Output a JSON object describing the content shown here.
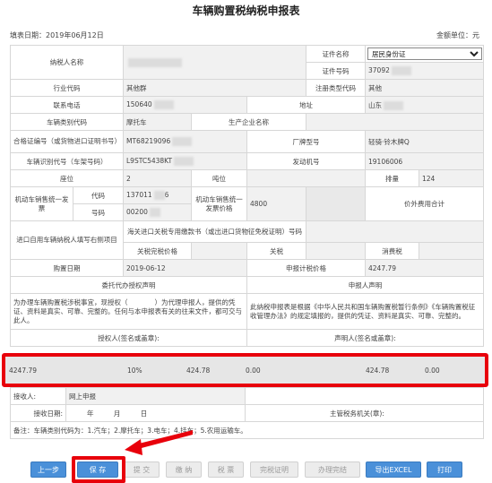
{
  "header": {
    "title": "车辆购置税纳税申报表",
    "fill_date": "填表日期：2019年06月12日",
    "unit": "金额单位：元"
  },
  "taxpayer": {
    "name_label": "纳税人名称",
    "cert_name_label": "证件名称",
    "cert_name_value": "居民身份证",
    "cert_no_label": "证件号码",
    "cert_no_value": "37092",
    "industry_label": "行业代码",
    "industry_value": "其他群",
    "reg_type_label": "注册类型代码",
    "reg_type_value": "其他",
    "phone_label": "联系电话",
    "phone_value": "150640",
    "address_label": "地址",
    "address_value": "山东"
  },
  "vehicle": {
    "type_label": "车辆类别代码",
    "type_value": "摩托车",
    "maker_label": "生产企业名称",
    "cert_label": "合格证编号（或货物进口证明书号）",
    "cert_value": "MT68219096",
    "model_label": "厂牌型号",
    "model_value": "轻骑·铃木牌Q",
    "vin_label": "车辆识别代号（车架号码）",
    "vin_value": "L9STC5438KT",
    "engine_label": "发动机号",
    "engine_value": "19106006",
    "seats_label": "座位",
    "seats_value": "2",
    "tonnage_label": "吨位",
    "displacement_label": "排量",
    "displacement_value": "124",
    "invoice_label": "机动车销售统一发票",
    "code_label": "代码",
    "code_value": "137011",
    "code_suffix": "6",
    "number_label": "号码",
    "number_value": "00200",
    "price_label": "机动车销售统一发票价格",
    "price_value": "4800",
    "extra_fee_label": "价外费用合计"
  },
  "import": {
    "self_use_label": "进口自用车辆纳税人填写右侧项目",
    "customs_label": "海关进口关税专用缴款书（或出进口货物征免税证明）号码",
    "customs_value_label": "关税完税价格",
    "tariff_label": "关税",
    "consumption_label": "消费税"
  },
  "purchase": {
    "date_label": "购置日期",
    "date_value": "2019-06-12",
    "declared_price_label": "申报计税价格",
    "declared_price_value": "4247.79"
  },
  "declaration": {
    "agent_title": "委托代办授权声明",
    "agent_text": "为办理车辆购置税涉税事宜，现授权（　　　　）为代理申报人，提供的凭证、资料是真实、可靠、完整的。任何与本申报表有关的往来文件，都可交与此人。",
    "declarant_title": "申报人声明",
    "declarant_text": "此纳税申报表是根据《中华人民共和国车辆购置税暂行条例》《车辆购置税征收管理办法》的规定填报的，提供的凭证、资料是真实、可靠、完整的。",
    "agent_sign": "授权人(签名或盖章):",
    "declarant_sign": "声明人(签名或盖章):"
  },
  "totals": {
    "tax_base": "4247.79",
    "rate": "10%",
    "tax_payable": "424.78",
    "reduction": "0.00",
    "tax_due": "424.78",
    "paid": "0.00"
  },
  "receipt": {
    "receiver_label": "接收人:",
    "receiver_value": "网上申报",
    "date_label": "接收日期:",
    "year": "年",
    "month": "月",
    "day": "日",
    "office_label": "主管税务机关(章):"
  },
  "note": "备注：车辆类别代码为：1.汽车；2.摩托车；3.电车；4.挂车；5.农用运输车。",
  "buttons": {
    "prev": "上一步",
    "save": "保 存",
    "submit": "提 交",
    "pay": "缴 纳",
    "tax_ticket": "税 票",
    "tax_cert": "完税证明",
    "finish": "办理完结",
    "export": "导出EXCEL",
    "print": "打印"
  },
  "colors": {
    "highlight": "#e8000b",
    "button_active": "#4a90d9",
    "button_disabled": "#ececec"
  }
}
